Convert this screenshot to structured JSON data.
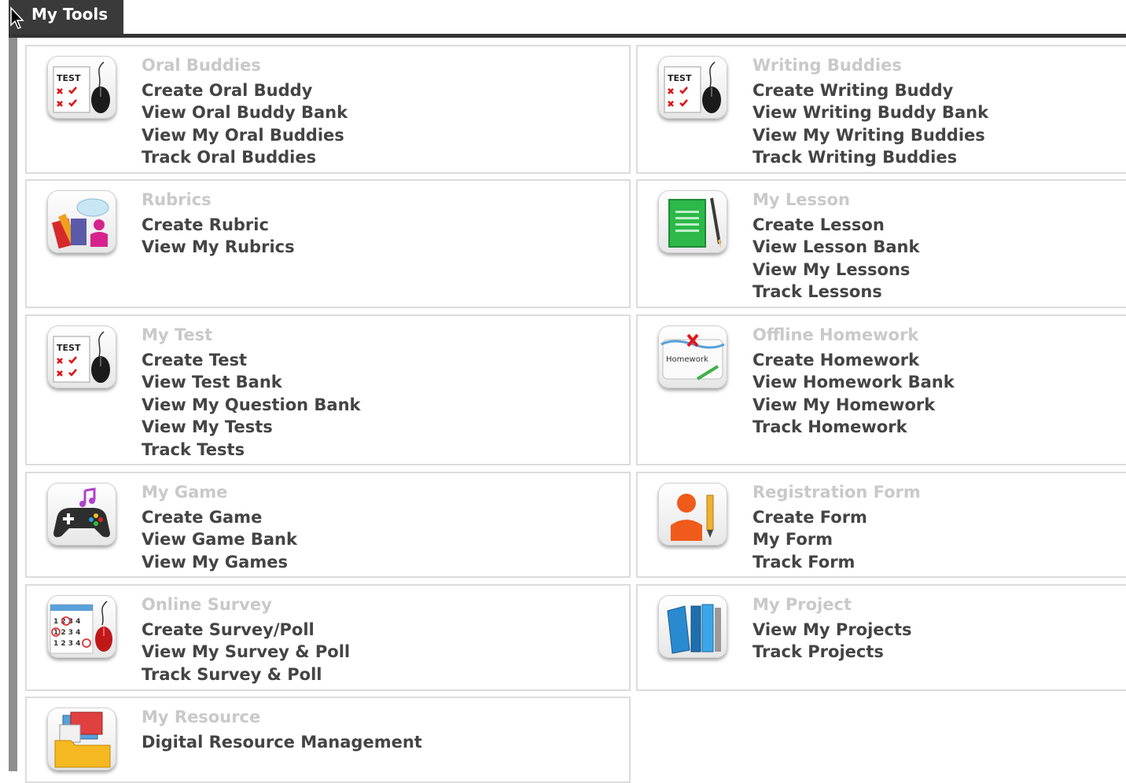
{
  "header": {
    "title": "My Tools"
  },
  "panels": {
    "oral": {
      "title": "Oral Buddies",
      "links": [
        "Create Oral Buddy",
        "View Oral Buddy Bank",
        "View My Oral Buddies",
        "Track Oral Buddies"
      ]
    },
    "writing": {
      "title": "Writing Buddies",
      "links": [
        "Create Writing Buddy",
        "View Writing Buddy Bank",
        "View My Writing Buddies",
        "Track Writing Buddies"
      ]
    },
    "rubrics": {
      "title": "Rubrics",
      "links": [
        "Create Rubric",
        "View My Rubrics"
      ]
    },
    "lesson": {
      "title": "My Lesson",
      "links": [
        "Create Lesson",
        "View Lesson Bank",
        "View My Lessons",
        "Track Lessons"
      ]
    },
    "test": {
      "title": "My Test",
      "links": [
        "Create Test",
        "View Test Bank",
        "View My Question Bank",
        "View My Tests",
        "Track Tests"
      ]
    },
    "homework": {
      "title": "Offline Homework",
      "icon_text": "Homework",
      "links": [
        "Create Homework",
        "View Homework Bank",
        "View My Homework",
        "Track Homework"
      ]
    },
    "game": {
      "title": "My Game",
      "links": [
        "Create Game",
        "View Game Bank",
        "View My Games"
      ]
    },
    "registration": {
      "title": "Registration Form",
      "links": [
        "Create Form",
        "My Form",
        "Track Form"
      ]
    },
    "survey": {
      "title": "Online Survey",
      "links": [
        "Create Survey/Poll",
        "View My Survey & Poll",
        "Track Survey & Poll"
      ]
    },
    "project": {
      "title": "My Project",
      "links": [
        "View My Projects",
        "Track Projects"
      ]
    },
    "resource": {
      "title": "My Resource",
      "links": [
        "Digital Resource Management"
      ]
    }
  },
  "icons": {
    "test_label": "TEST",
    "survey_rows": [
      "1 2 3 4",
      "1 2 3 4",
      "1 2 3 4"
    ]
  },
  "colors": {
    "title_bar": "#3a3a3a",
    "section_title": "#c9c9c9",
    "link_text": "#444444",
    "panel_border": "#dcdcdc"
  }
}
